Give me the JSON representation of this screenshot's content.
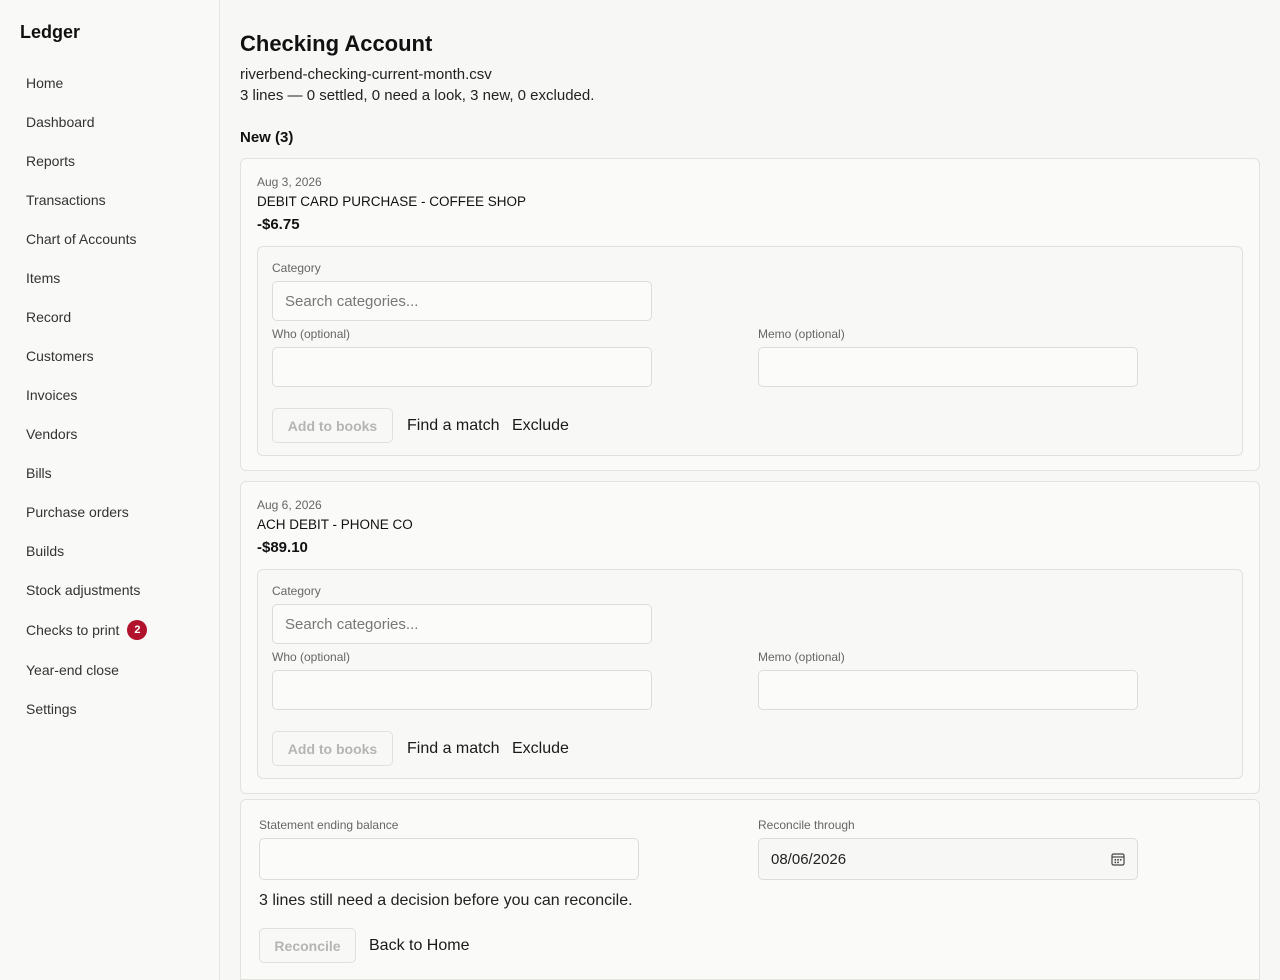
{
  "sidebar": {
    "brand": "Ledger",
    "items": [
      {
        "label": "Home"
      },
      {
        "label": "Dashboard"
      },
      {
        "label": "Reports"
      },
      {
        "label": "Transactions"
      },
      {
        "label": "Chart of Accounts"
      },
      {
        "label": "Items"
      },
      {
        "label": "Record"
      },
      {
        "label": "Customers"
      },
      {
        "label": "Invoices"
      },
      {
        "label": "Vendors"
      },
      {
        "label": "Bills"
      },
      {
        "label": "Purchase orders"
      },
      {
        "label": "Builds"
      },
      {
        "label": "Stock adjustments"
      },
      {
        "label": "Checks to print",
        "badge": "2"
      },
      {
        "label": "Year-end close"
      },
      {
        "label": "Settings"
      }
    ]
  },
  "header": {
    "title": "Checking Account",
    "file_name": "riverbend-checking-current-month.csv",
    "summary": "3 lines — 0 settled, 0 need a look, 3 new, 0 excluded."
  },
  "section": {
    "heading": "New (3)"
  },
  "labels": {
    "category": "Category",
    "category_placeholder": "Search categories...",
    "who": "Who (optional)",
    "memo": "Memo (optional)",
    "add_to_books": "Add to books",
    "find_match": "Find a match",
    "exclude": "Exclude"
  },
  "transactions": [
    {
      "date": "Aug 3, 2026",
      "description": "DEBIT CARD PURCHASE - COFFEE SHOP",
      "amount": "-$6.75"
    },
    {
      "date": "Aug 6, 2026",
      "description": "ACH DEBIT - PHONE CO",
      "amount": "-$89.10"
    }
  ],
  "reconcile": {
    "balance_label": "Statement ending balance",
    "balance_value": "",
    "through_label": "Reconcile through",
    "through_value": "08/06/2026",
    "message": "3 lines still need a decision before you can reconcile.",
    "reconcile_button": "Reconcile",
    "back_button": "Back to Home"
  },
  "colors": {
    "badge": "#b0132b",
    "background": "#f7f7f6"
  }
}
